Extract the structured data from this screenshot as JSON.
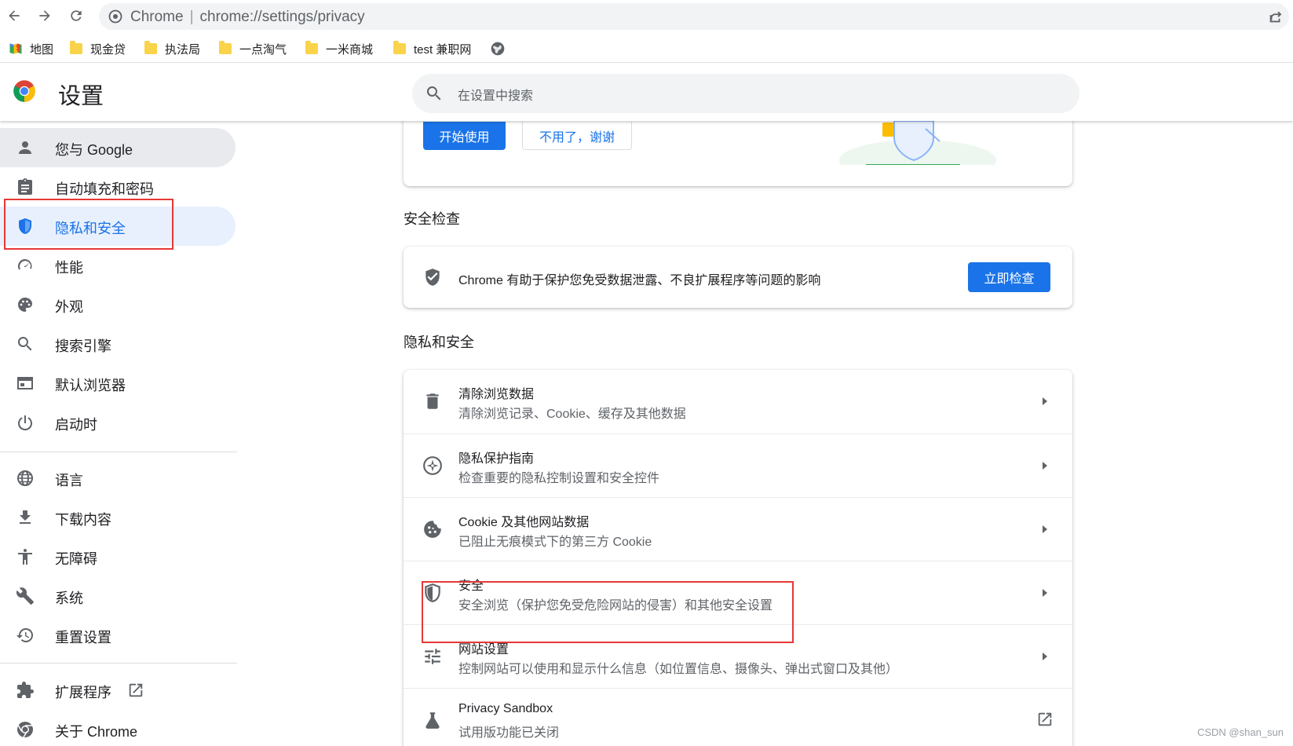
{
  "browser": {
    "site_label": "Chrome",
    "url": "chrome://settings/privacy"
  },
  "bookmarks": [
    {
      "label": "地图",
      "icon": "maps-icon"
    },
    {
      "label": "现金贷",
      "icon": "folder-icon"
    },
    {
      "label": "执法局",
      "icon": "folder-icon"
    },
    {
      "label": "一点淘气",
      "icon": "folder-icon"
    },
    {
      "label": "一米商城",
      "icon": "folder-icon"
    },
    {
      "label": "test 兼职网",
      "icon": "folder-icon"
    }
  ],
  "header": {
    "title": "设置",
    "search_placeholder": "在设置中搜索"
  },
  "sidebar": {
    "items": [
      {
        "label": "您与 Google",
        "icon": "person-icon"
      },
      {
        "label": "自动填充和密码",
        "icon": "clipboard-icon"
      },
      {
        "label": "隐私和安全",
        "icon": "shield-icon"
      },
      {
        "label": "性能",
        "icon": "speedometer-icon"
      },
      {
        "label": "外观",
        "icon": "palette-icon"
      },
      {
        "label": "搜索引擎",
        "icon": "search-icon"
      },
      {
        "label": "默认浏览器",
        "icon": "browser-window-icon"
      },
      {
        "label": "启动时",
        "icon": "power-icon"
      },
      {
        "label": "语言",
        "icon": "globe-icon"
      },
      {
        "label": "下载内容",
        "icon": "download-icon"
      },
      {
        "label": "无障碍",
        "icon": "accessibility-icon"
      },
      {
        "label": "系统",
        "icon": "wrench-icon"
      },
      {
        "label": "重置设置",
        "icon": "restore-icon"
      },
      {
        "label": "扩展程序",
        "icon": "puzzle-icon"
      },
      {
        "label": "关于 Chrome",
        "icon": "chrome-icon"
      }
    ]
  },
  "promo": {
    "start_label": "开始使用",
    "decline_label": "不用了，谢谢"
  },
  "safety_check": {
    "section_title": "安全检查",
    "description": "Chrome 有助于保护您免受数据泄露、不良扩展程序等问题的影响",
    "button_label": "立即检查"
  },
  "privacy": {
    "section_title": "隐私和安全",
    "rows": [
      {
        "title": "清除浏览数据",
        "subtitle": "清除浏览记录、Cookie、缓存及其他数据",
        "icon": "trash-icon"
      },
      {
        "title": "隐私保护指南",
        "subtitle": "检查重要的隐私控制设置和安全控件",
        "icon": "compass-icon"
      },
      {
        "title": "Cookie 及其他网站数据",
        "subtitle": "已阻止无痕模式下的第三方 Cookie",
        "icon": "cookie-icon"
      },
      {
        "title": "安全",
        "subtitle": "安全浏览（保护您免受危险网站的侵害）和其他安全设置",
        "icon": "security-shield-icon"
      },
      {
        "title": "网站设置",
        "subtitle": "控制网站可以使用和显示什么信息（如位置信息、摄像头、弹出式窗口及其他）",
        "icon": "tune-icon"
      },
      {
        "title": "Privacy Sandbox",
        "subtitle": "试用版功能已关闭",
        "icon": "flask-icon"
      }
    ]
  },
  "watermark": "CSDN @shan_sun",
  "colors": {
    "accent": "#1a73e8",
    "highlight_box": "#e53935",
    "active_bg": "#e8f0fe"
  }
}
